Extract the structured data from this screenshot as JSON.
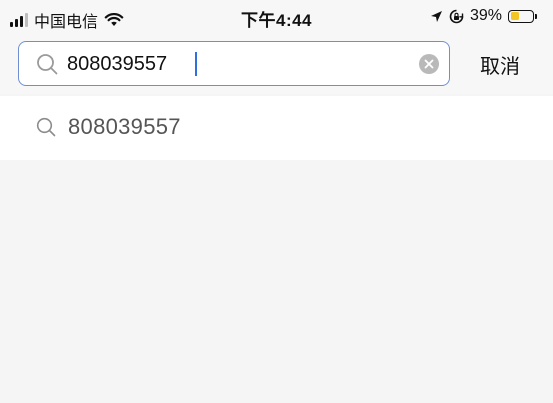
{
  "status_bar": {
    "carrier": "中国电信",
    "time": "下午4:44",
    "battery_percent": "39%",
    "battery_level": 0.39,
    "battery_color": "#f3c623",
    "icons": [
      "signal-icon",
      "wifi-icon",
      "location-icon",
      "orientation-lock-icon",
      "battery-icon"
    ]
  },
  "search": {
    "value": "808039557",
    "placeholder": "",
    "accent_color": "#6e8fd6",
    "cancel_label": "取消"
  },
  "suggestions": [
    {
      "text": "808039557",
      "icon": "search-icon"
    }
  ]
}
